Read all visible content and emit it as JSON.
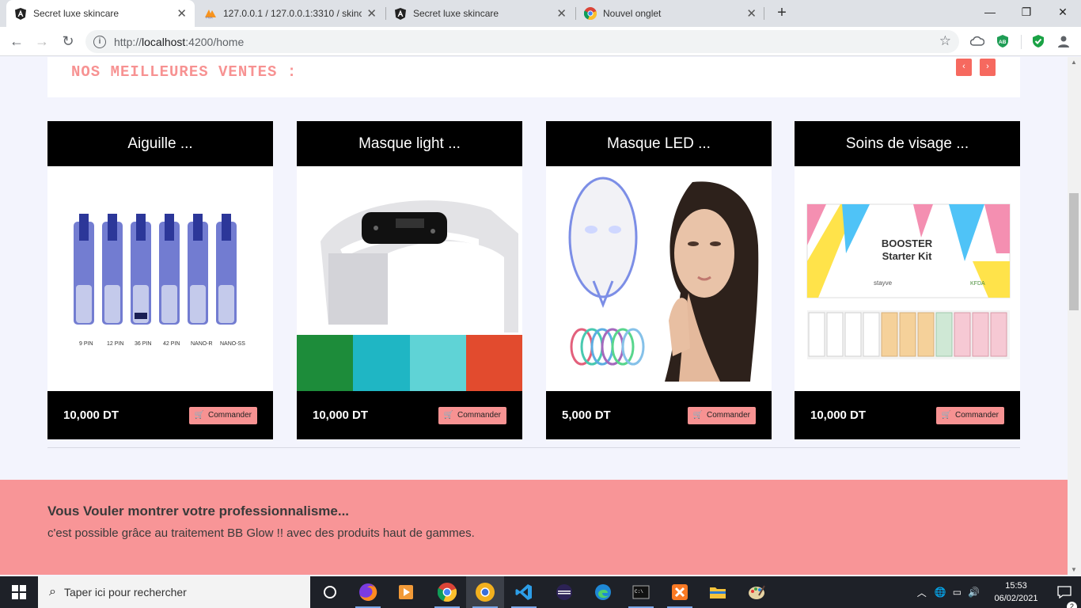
{
  "browser": {
    "tabs": [
      {
        "title": "Secret luxe skincare",
        "active": true,
        "favicon": "angular-icon"
      },
      {
        "title": "127.0.0.1 / 127.0.0.1:3310 / skinca",
        "active": false,
        "favicon": "phpmyadmin-icon"
      },
      {
        "title": "Secret luxe skincare",
        "active": false,
        "favicon": "angular-icon"
      },
      {
        "title": "Nouvel onglet",
        "active": false,
        "favicon": "chrome-icon"
      }
    ],
    "url_scheme": "http://",
    "url_host": "localhost",
    "url_rest": ":4200/home",
    "extensions": [
      "cloud-icon",
      "adblock-icon",
      "shield-check-icon"
    ]
  },
  "page": {
    "section_title": "NOS MEILLEURES VENTES :",
    "prev_label": "‹",
    "next_label": "›",
    "products": [
      {
        "name": "Aiguille ...",
        "price": "10,000 DT",
        "button": "Commander",
        "image": "microneedle-cartridges"
      },
      {
        "name": "Masque light ...",
        "price": "10,000 DT",
        "button": "Commander",
        "image": "led-light-panel"
      },
      {
        "name": "Masque LED ...",
        "price": "5,000 DT",
        "button": "Commander",
        "image": "led-face-mask"
      },
      {
        "name": "Soins de visage ...",
        "price": "10,000 DT",
        "button": "Commander",
        "image": "booster-starter-kit"
      }
    ],
    "image_text": {
      "needle_labels": [
        "9 PIN",
        "12 PIN",
        "36 PIN",
        "42 PIN",
        "NANO-R",
        "NANO-SS"
      ],
      "kit_title_1": "BOOSTER",
      "kit_title_2": "Starter Kit",
      "kit_brand": "stayve",
      "kit_logo": "KFDA"
    },
    "promo_title": "Vous Vouler montrer votre professionnalisme...",
    "promo_text": "c'est possible grâce au traitement BB Glow !! avec des produits haut de gammes."
  },
  "taskbar": {
    "search_placeholder": "Taper ici pour rechercher",
    "time": "15:53",
    "date": "06/02/2021",
    "notifications": "2",
    "colors": {
      "accent": "#f79292",
      "button_red": "#f6695f",
      "promo_bg": "#f89597"
    }
  }
}
